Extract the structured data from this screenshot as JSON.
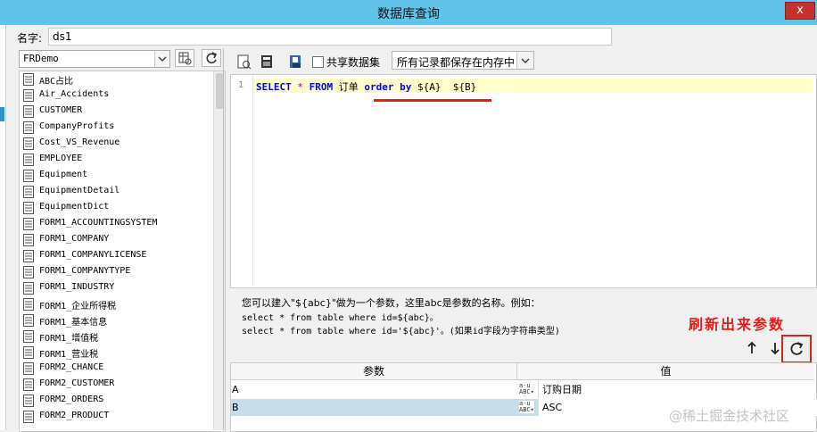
{
  "window": {
    "title": "数据库查询",
    "close_label": "x"
  },
  "name_field": {
    "label": "名字:",
    "value": "ds1"
  },
  "datasource": {
    "selected": "FRDemo"
  },
  "tables": [
    "ABC占比",
    "Air_Accidents",
    "CUSTOMER",
    "CompanyProfits",
    "Cost_VS_Revenue",
    "EMPLOYEE",
    "Equipment",
    "EquipmentDetail",
    "EquipmentDict",
    "FORM1_ACCOUNTINGSYSTEM",
    "FORM1_COMPANY",
    "FORM1_COMPANYLICENSE",
    "FORM1_COMPANYTYPE",
    "FORM1_INDUSTRY",
    "FORM1_企业所得税",
    "FORM1_基本信息",
    "FORM1_增值税",
    "FORM1_营业税",
    "FORM2_CHANCE",
    "FORM2_CUSTOMER",
    "FORM2_ORDERS",
    "FORM2_PRODUCT"
  ],
  "toolbar": {
    "share_label": "共享数据集",
    "memory_option": "所有记录都保存在内存中"
  },
  "editor": {
    "line_number": "1",
    "tokens": {
      "select": "SELECT",
      "star": "*",
      "from": "FROM",
      "table": "订单",
      "orderby": "order by",
      "paramA": "${A}",
      "paramB": "${B}"
    }
  },
  "help": {
    "line1": "您可以建入\"${abc}\"做为一个参数，这里abc是参数的名称。例如：",
    "line2": "select * from table where id=${abc}。",
    "line3": "select * from table where id='${abc}'。(如果id字段为字符串类型)"
  },
  "annotation": "刷新出来参数",
  "params": {
    "header_name": "参数",
    "header_value": "值",
    "rows": [
      {
        "name": "A",
        "value": "订购日期"
      },
      {
        "name": "B",
        "value": "ASC"
      }
    ]
  },
  "watermark": "@稀土掘金技术社区",
  "colors": {
    "titlebar": "#5fc3ea",
    "annotation": "#e02020",
    "keyword": "#0000ff",
    "selected_row": "#c9dcea"
  }
}
